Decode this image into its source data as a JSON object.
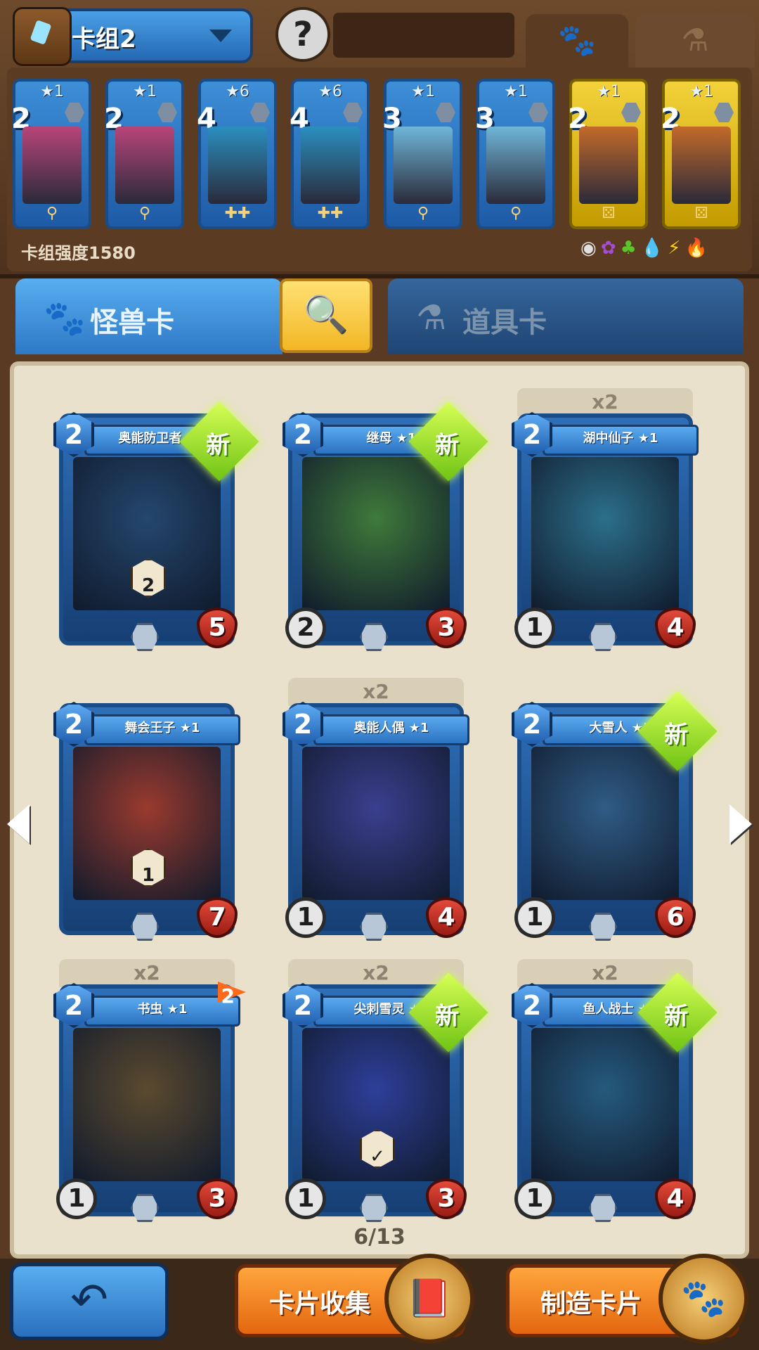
{
  "header": {
    "deck_name": "卡组2",
    "avatar_glyph": "?",
    "tab_monster_icon": "paw-icon",
    "tab_item_icon": "potion-icon"
  },
  "deck": {
    "power_label": "卡组强度1580",
    "element_icons": [
      "neutral",
      "arcane",
      "nature",
      "water",
      "lightning",
      "fire"
    ],
    "cards": [
      {
        "stars": "★1",
        "cost": "2",
        "frame": "blue",
        "art_color": "#b8457a",
        "foot": "⚲"
      },
      {
        "stars": "★1",
        "cost": "2",
        "frame": "blue",
        "art_color": "#b8457a",
        "foot": "⚲"
      },
      {
        "stars": "★6",
        "cost": "4",
        "frame": "blue",
        "art_color": "#2a8fc0",
        "foot": "✚✚"
      },
      {
        "stars": "★6",
        "cost": "4",
        "frame": "blue",
        "art_color": "#2a8fc0",
        "foot": "✚✚"
      },
      {
        "stars": "★1",
        "cost": "3",
        "frame": "blue",
        "art_color": "#6fb6d8",
        "foot": "⚲"
      },
      {
        "stars": "★1",
        "cost": "3",
        "frame": "blue",
        "art_color": "#6fb6d8",
        "foot": "⚲"
      },
      {
        "stars": "★1",
        "cost": "2",
        "frame": "gold",
        "art_color": "#c46a2a",
        "foot": "⚄"
      },
      {
        "stars": "★1",
        "cost": "2",
        "frame": "gold",
        "art_color": "#c46a2a",
        "foot": "⚄"
      }
    ]
  },
  "tabs": {
    "monster": "怪兽卡",
    "item": "道具卡",
    "search_icon": "search-icon"
  },
  "collection": {
    "page": "6/13",
    "cards": [
      {
        "name": "奥能防卫者 ★1",
        "cost": "2",
        "atk": "",
        "hp": "5",
        "count": "",
        "new": "新",
        "badge": "2",
        "flag": "",
        "art_color": "#24476e"
      },
      {
        "name": "继母 ★1",
        "cost": "2",
        "atk": "2",
        "hp": "3",
        "count": "",
        "new": "新",
        "badge": "",
        "flag": "",
        "art_color": "#3f7a3a"
      },
      {
        "name": "湖中仙子 ★1",
        "cost": "2",
        "atk": "1",
        "hp": "4",
        "count": "x2",
        "new": "",
        "badge": "",
        "flag": "",
        "art_color": "#2c6f8a"
      },
      {
        "name": "舞会王子 ★1",
        "cost": "2",
        "atk": "",
        "hp": "7",
        "count": "",
        "new": "",
        "badge": "1",
        "flag": "",
        "art_color": "#9a3a2e"
      },
      {
        "name": "奥能人偶 ★1",
        "cost": "2",
        "atk": "1",
        "hp": "4",
        "count": "x2",
        "new": "",
        "badge": "",
        "flag": "",
        "art_color": "#3b3f8f"
      },
      {
        "name": "大雪人 ★1",
        "cost": "2",
        "atk": "1",
        "hp": "6",
        "count": "",
        "new": "新",
        "badge": "",
        "flag": "",
        "art_color": "#2f5c86"
      },
      {
        "name": "书虫 ★1",
        "cost": "2",
        "atk": "1",
        "hp": "3",
        "count": "x2",
        "new": "",
        "badge": "",
        "flag": "2",
        "art_color": "#5b4a2f"
      },
      {
        "name": "尖刺雪灵 ★1",
        "cost": "2",
        "atk": "1",
        "hp": "3",
        "count": "x2",
        "new": "新",
        "badge": "✓",
        "flag": "",
        "art_color": "#2e3f9a"
      },
      {
        "name": "鱼人战士 ★1",
        "cost": "2",
        "atk": "1",
        "hp": "4",
        "count": "x2",
        "new": "新",
        "badge": "",
        "flag": "",
        "art_color": "#255a7e"
      }
    ]
  },
  "footer": {
    "back_icon": "back-arrow-icon",
    "collect_label": "卡片收集",
    "craft_label": "制造卡片"
  }
}
